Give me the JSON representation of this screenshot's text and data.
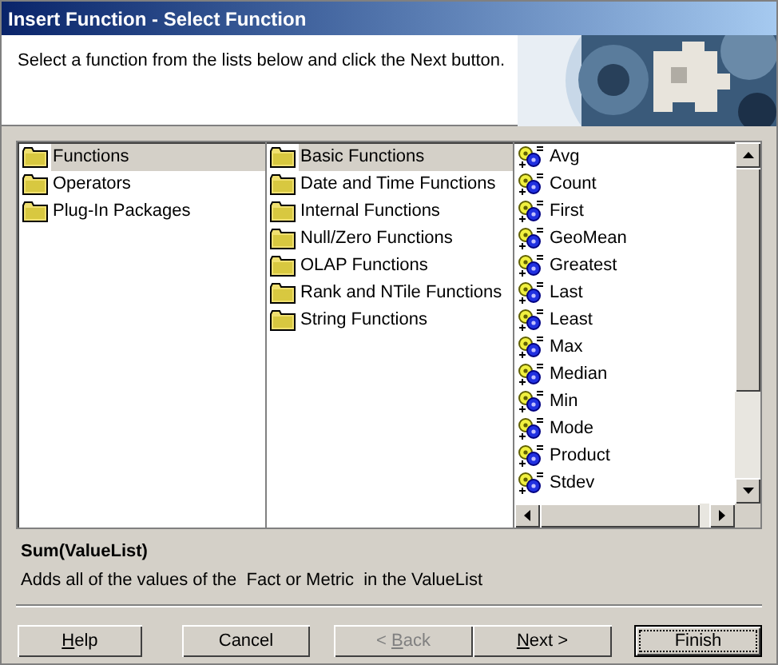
{
  "window": {
    "title": "Insert Function - Select Function"
  },
  "header": {
    "instruction": "Select a function from the lists below and click the Next button."
  },
  "categories": [
    {
      "label": "Functions",
      "selected": true
    },
    {
      "label": "Operators",
      "selected": false
    },
    {
      "label": "Plug-In Packages",
      "selected": false
    }
  ],
  "groups": [
    {
      "label": "Basic Functions",
      "selected": true
    },
    {
      "label": "Date and Time Functions",
      "selected": false
    },
    {
      "label": "Internal Functions",
      "selected": false
    },
    {
      "label": "Null/Zero Functions",
      "selected": false
    },
    {
      "label": "OLAP Functions",
      "selected": false
    },
    {
      "label": "Rank and NTile Functions",
      "selected": false
    },
    {
      "label": "String Functions",
      "selected": false
    }
  ],
  "functions": [
    {
      "label": "Avg"
    },
    {
      "label": "Count"
    },
    {
      "label": "First"
    },
    {
      "label": "GeoMean"
    },
    {
      "label": "Greatest"
    },
    {
      "label": "Last"
    },
    {
      "label": "Least"
    },
    {
      "label": "Max"
    },
    {
      "label": "Median"
    },
    {
      "label": "Min"
    },
    {
      "label": "Mode"
    },
    {
      "label": "Product"
    },
    {
      "label": "Stdev"
    }
  ],
  "description": {
    "signature": "Sum(ValueList)",
    "text": "Adds all of the values of the  Fact or Metric  in the ValueList"
  },
  "buttons": [
    {
      "parts": [
        {
          "text": "H",
          "underlined": true
        },
        {
          "text": "elp",
          "underlined": false
        }
      ],
      "disabled": false,
      "default": false
    },
    {
      "parts": [
        {
          "text": "Cancel",
          "underlined": false
        }
      ],
      "disabled": false,
      "default": false
    },
    {
      "parts": [
        {
          "text": "< ",
          "underlined": false
        },
        {
          "text": "B",
          "underlined": true
        },
        {
          "text": "ack",
          "underlined": false
        }
      ],
      "disabled": true,
      "default": false
    },
    {
      "parts": [
        {
          "text": "N",
          "underlined": true
        },
        {
          "text": "ext >",
          "underlined": false
        }
      ],
      "disabled": false,
      "default": false
    },
    {
      "parts": [
        {
          "text": "Finish",
          "underlined": false
        }
      ],
      "disabled": false,
      "default": true
    }
  ]
}
